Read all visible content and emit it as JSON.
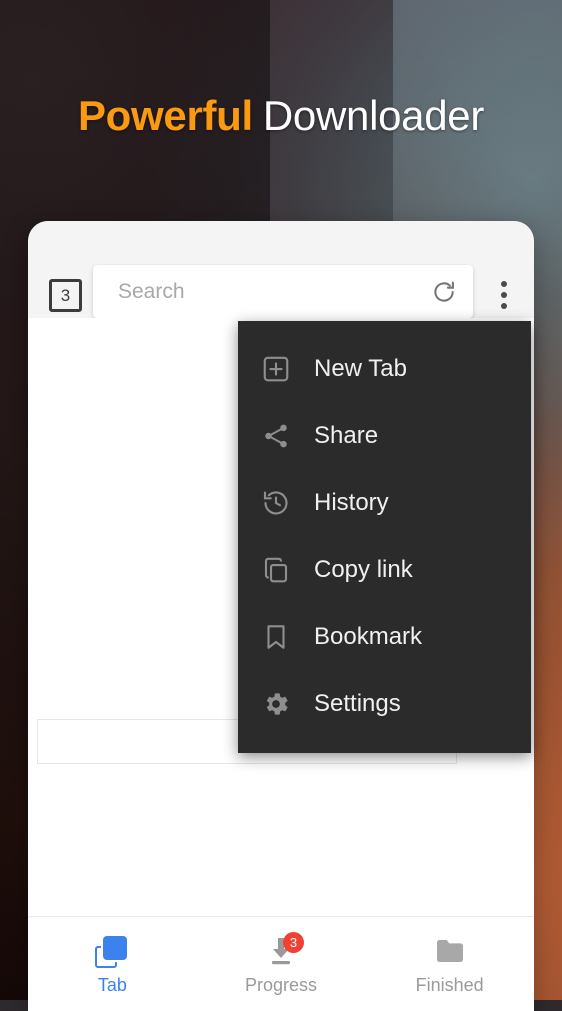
{
  "headline": {
    "strong": "Powerful",
    "rest": "Downloader",
    "strong_color": "#f99a12",
    "rest_color": "#ffffff"
  },
  "browser": {
    "toolbar": {
      "tab_count": "3",
      "search_placeholder": "Search",
      "refresh_icon": "refresh-icon",
      "overflow_icon": "more-vertical-icon"
    },
    "menu": {
      "background": "#2b2b2b",
      "items": [
        {
          "label": "New Tab",
          "icon": "new-tab-icon"
        },
        {
          "label": "Share",
          "icon": "share-icon"
        },
        {
          "label": "History",
          "icon": "history-icon"
        },
        {
          "label": "Copy link",
          "icon": "copy-link-icon"
        },
        {
          "label": "Bookmark",
          "icon": "bookmark-icon"
        },
        {
          "label": "Settings",
          "icon": "settings-gear-icon"
        }
      ]
    },
    "bottom_nav": {
      "active_color": "#3d82ec",
      "inactive_color": "#9a9a9a",
      "badge_color": "#f04134",
      "items": [
        {
          "label": "Tab",
          "icon": "tabs-icon",
          "badge": "",
          "active": "true"
        },
        {
          "label": "Progress",
          "icon": "download-icon",
          "badge": "3",
          "active": "false"
        },
        {
          "label": "Finished",
          "icon": "folder-icon",
          "badge": "",
          "active": "false"
        }
      ]
    }
  }
}
